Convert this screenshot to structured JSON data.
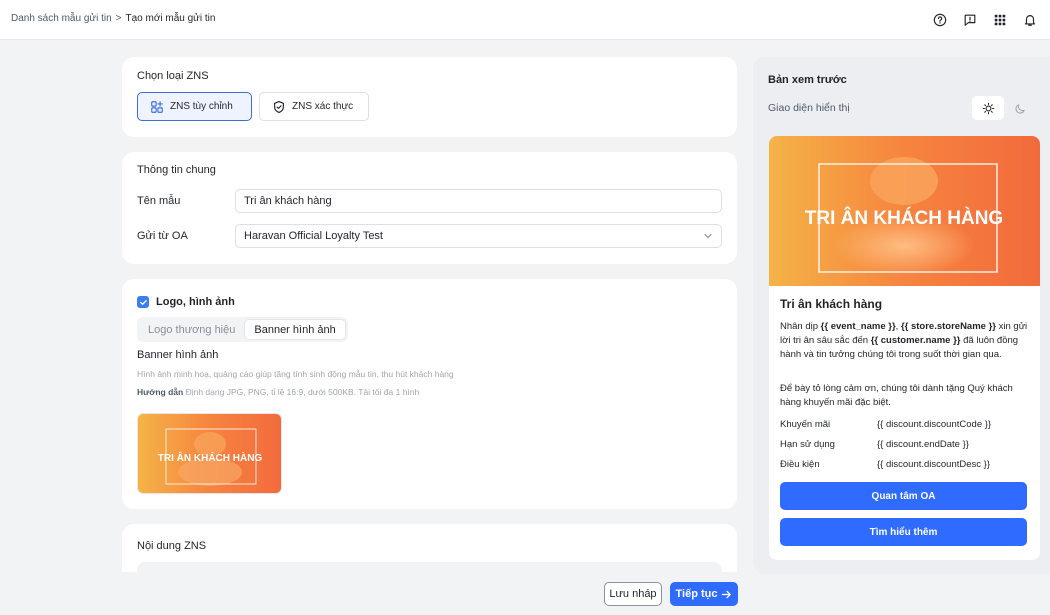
{
  "breadcrumb": {
    "parent": "Danh sách mẫu gửi tin",
    "separator": ">",
    "current": "Tạo mới mẫu gửi tin"
  },
  "topbar_icons": [
    "help-circle-icon",
    "feedback-icon",
    "apps-grid-icon",
    "bell-icon"
  ],
  "zns_type": {
    "title": "Chọn loại ZNS",
    "options": [
      {
        "label": "ZNS tùy chỉnh",
        "icon": "custom-grid-icon",
        "selected": true
      },
      {
        "label": "ZNS xác thực",
        "icon": "shield-check-icon",
        "selected": false
      }
    ]
  },
  "general": {
    "title": "Thông tin chung",
    "name_label": "Tên mẫu",
    "name_value": "Tri ân khách hàng",
    "oa_label": "Gửi từ OA",
    "oa_value": "Haravan Official Loyalty Test"
  },
  "logo": {
    "checkbox_label": "Logo, hình ảnh",
    "checked": true,
    "tabs": [
      "Logo thương hiệu",
      "Banner hình ảnh"
    ],
    "active_tab": 1,
    "section_label": "Banner hình ảnh",
    "hint": "Hình ảnh minh hoạ, quảng cáo giúp tăng tính sinh động mẫu tin, thu hút khách hàng",
    "guide_label": "Hướng dẫn",
    "guide_text": "Định dạng JPG, PNG, tỉ lệ 16:9, dưới 500KB. Tải tối đa 1 hình",
    "thumb_text": "TRI ÂN KHÁCH HÀNG"
  },
  "content": {
    "title": "Nội dung ZNS"
  },
  "preview": {
    "title": "Bản xem trước",
    "display_label": "Giao diện hiển thị",
    "theme": "light",
    "banner_text": "TRI ÂN KHÁCH HÀNG",
    "heading": "Tri ân khách hàng",
    "para1": {
      "t1": "Nhân dịp ",
      "v1": "{{ event_name }}",
      "t2": ", ",
      "v2": "{{ store.storeName }}",
      "t3": " xin gửi lời tri ân sâu sắc đến ",
      "v3": "{{ customer.name }}",
      "t4": " đã luôn đồng hành và tin tưởng chúng tôi trong suốt thời gian qua."
    },
    "para2": "Để bày tỏ lòng cảm ơn, chúng tôi dành tặng Quý khách hàng khuyến mãi đặc biệt.",
    "rows": [
      {
        "key": "Khuyến mãi",
        "value": "{{ discount.discountCode }}"
      },
      {
        "key": "Hạn sử dụng",
        "value": "{{ discount.endDate }}"
      },
      {
        "key": "Điều kiện",
        "value": "{{ discount.discountDesc }}"
      }
    ],
    "btn_primary": "Quan tâm OA",
    "btn_secondary": "Tìm hiểu thêm"
  },
  "footer": {
    "draft_label": "Lưu nháp",
    "next_label": "Tiếp tục"
  },
  "colors": {
    "accent": "#2f6bff",
    "banner_orange": "#f07a3a"
  }
}
